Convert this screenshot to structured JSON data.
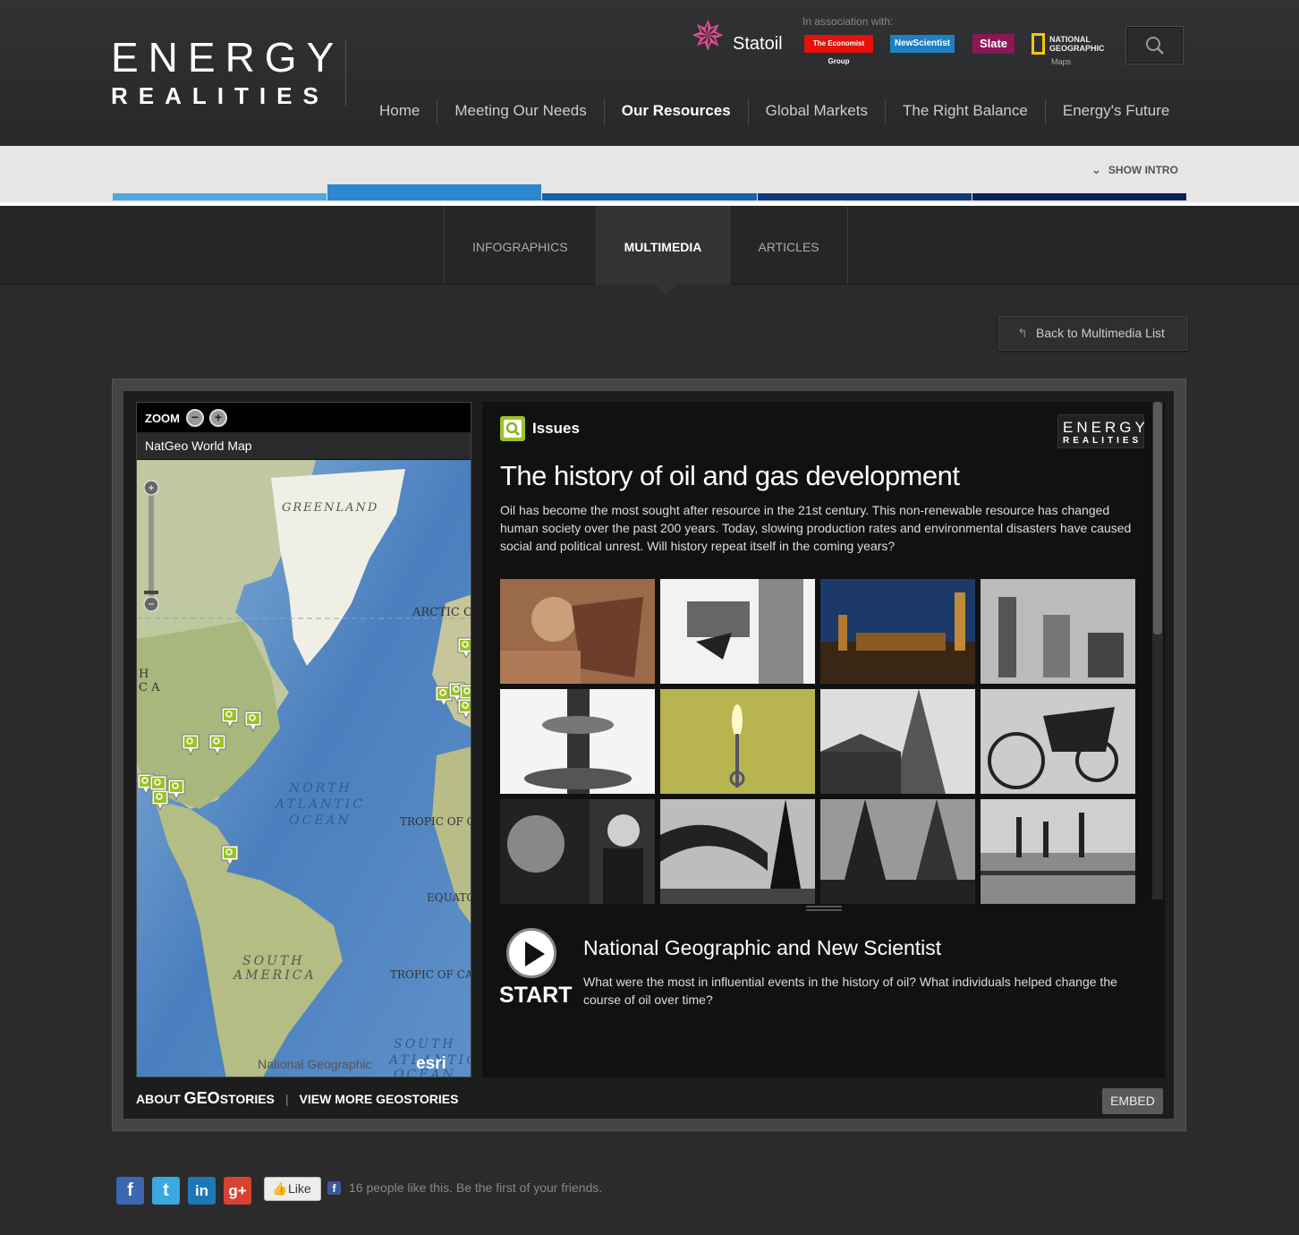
{
  "header": {
    "logo_line1": "ENERGY",
    "logo_line2": "REALITIES",
    "association_label": "In association with:",
    "partners": {
      "statoil": "Statoil",
      "economist": "The Economist Group",
      "newscientist": "NewScientist",
      "slate": "Slate",
      "natgeo": "NATIONAL GEOGRAPHIC",
      "natgeo_sub": "Maps"
    },
    "nav": [
      "Home",
      "Meeting Our Needs",
      "Our Resources",
      "Global Markets",
      "The Right Balance",
      "Energy's Future"
    ],
    "nav_active": "Our Resources"
  },
  "intro": {
    "show_intro": "SHOW INTRO",
    "progress_colors": [
      "#53a6df",
      "#2f87cf",
      "#1a62a8",
      "#10397a",
      "#0a2158"
    ]
  },
  "subnav": {
    "tabs": [
      "INFOGRAPHICS",
      "MULTIMEDIA",
      "ARTICLES"
    ],
    "active": "MULTIMEDIA"
  },
  "back_button": "Back to Multimedia List",
  "map": {
    "zoom_label": "ZOOM",
    "title": "NatGeo World Map",
    "labels": {
      "greenland": "GREENLAND",
      "arctic": "ARCTIC CI",
      "north_atlantic_1": "NORTH",
      "north_atlantic_2": "ATLANTIC",
      "north_atlantic_3": "OCEAN",
      "tropic_cancer": "TROPIC OF C",
      "equator": "EQUATO",
      "south_america_1": "SOUTH",
      "south_america_2": "AMERICA",
      "tropic_capricorn": "TROPIC OF CA",
      "south_atlantic_1": "SOUTH",
      "south_atlantic_2": "ATLANTIC",
      "south_atlantic_3": "OCEAN",
      "left_edge_1": "H",
      "left_edge_2": "C A",
      "credit": "National Geographic",
      "esri": "esri"
    }
  },
  "geostories": {
    "about_prefix": "ABOUT ",
    "about_geo": "GEO",
    "about_suffix": "STORIES",
    "view_more": "VIEW MORE GEOSTORIES",
    "embed": "EMBED"
  },
  "story": {
    "category": "Issues",
    "mini_logo_1": "ENERGY",
    "mini_logo_2": "REALITIES",
    "title": "The history of oil and gas development",
    "description": "Oil has become the most sought after resource in the 21st century.  This non-renewable resource has changed human society over the past 200 years. Today, slowing production rates and environmental disasters have caused social and political unrest. Will history repeat itself in the coming years?",
    "start": "START",
    "credit_title": "National Geographic and New Scientist",
    "credit_desc": "What were the most in influential events in the history of oil? What individuals helped change the course of oil over time?"
  },
  "social": {
    "like": "Like",
    "like_text": "16 people like this. Be the first of your friends."
  }
}
